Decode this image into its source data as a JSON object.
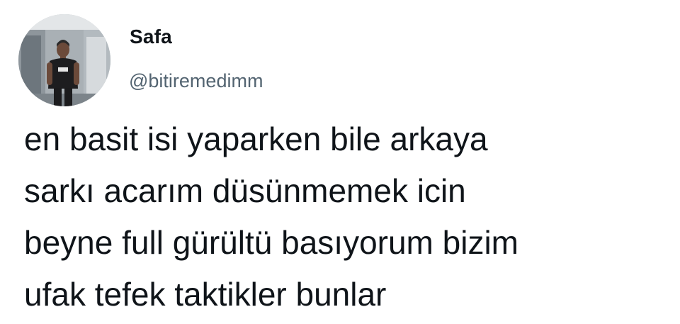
{
  "tweet": {
    "author": {
      "display_name": "Safa",
      "handle": "@bitiremedimm",
      "avatar_icon": "profile-photo"
    },
    "text_lines": [
      "en basit isi yaparken bile arkaya",
      "sarkı acarım düsünmemek icin",
      "beyne full gürültü basıyorum bizim",
      "ufak tefek taktikler bunlar"
    ]
  },
  "colors": {
    "background": "#ffffff",
    "text": "#0f1419",
    "handle": "#536471"
  }
}
